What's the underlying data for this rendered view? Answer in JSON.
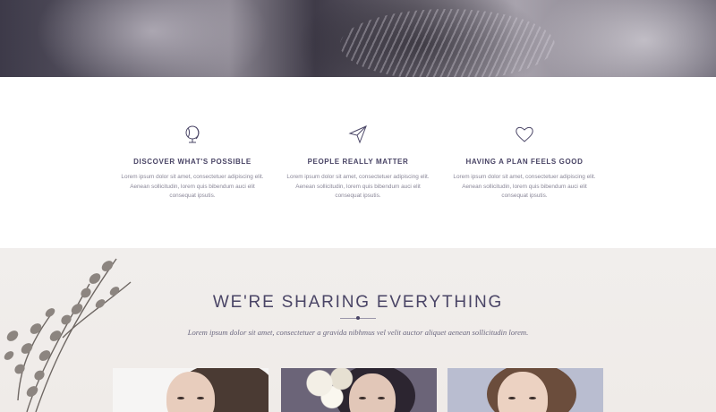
{
  "features": [
    {
      "icon": "globe-icon",
      "title": "DISCOVER WHAT'S POSSIBLE",
      "text": "Lorem ipsum dolor sit amet, consectetuer adipiscing elit. Aenean sollicitudin, lorem quis bibendum auci elit consequat ipsutis."
    },
    {
      "icon": "paper-plane-icon",
      "title": "PEOPLE REALLY MATTER",
      "text": "Lorem ipsum dolor sit amet, consectetuer adipiscing elit. Aenean sollicitudin, lorem quis bibendum auci elit consequat ipsutis."
    },
    {
      "icon": "heart-icon",
      "title": "HAVING A PLAN FEELS GOOD",
      "text": "Lorem ipsum dolor sit amet, consectetuer adipiscing elit. Aenean sollicitudin, lorem quis bibendum auci elit consequat ipsutis."
    }
  ],
  "sharing": {
    "title": "WE'RE SHARING EVERYTHING",
    "subtitle": "Lorem ipsum dolor sit amet, consectetuer a gravida nibhmus vel velit auctor aliquet aenean sollicitudin lorem."
  },
  "colors": {
    "heading": "#4a4566",
    "body_text": "#8a8798",
    "section_bg": "#f1eeec"
  }
}
